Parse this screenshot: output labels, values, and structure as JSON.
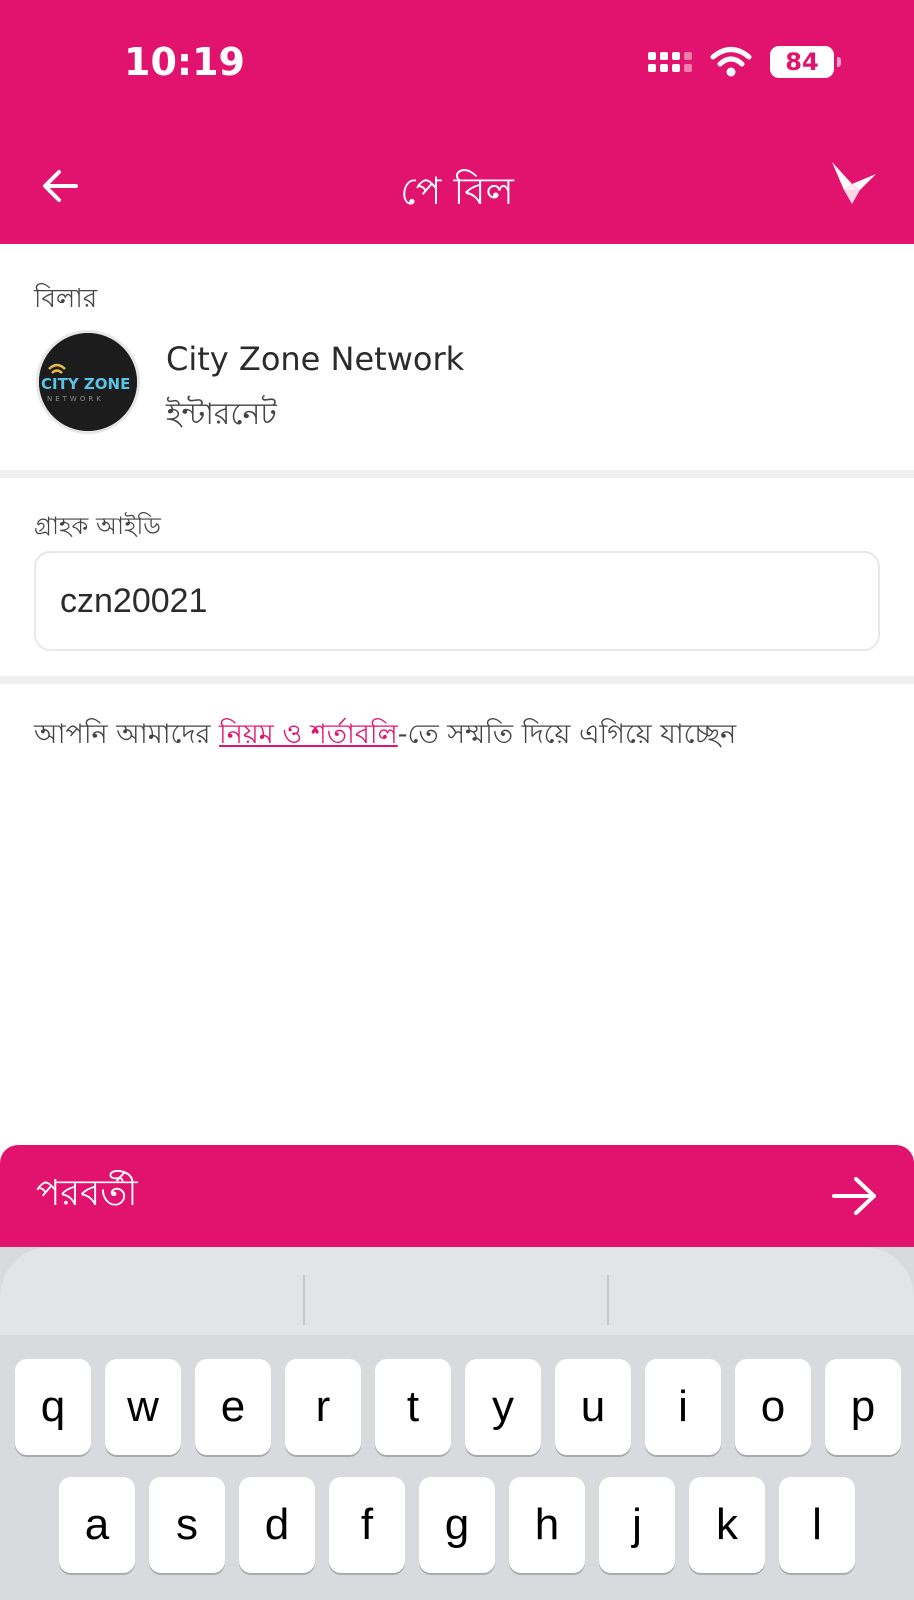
{
  "status_bar": {
    "time": "10:19",
    "battery": "84"
  },
  "header": {
    "title": "পে বিল"
  },
  "biller": {
    "label": "বিলার",
    "name": "City Zone Network",
    "category": "ইন্টারনেট",
    "logo_text_top": "CITY ZONE",
    "logo_text_bottom": "NETWORK"
  },
  "customer": {
    "label": "গ্রাহক আইডি",
    "value": "czn20021"
  },
  "terms": {
    "prefix": "আপনি আমাদের ",
    "link": "নিয়ম ও শর্তাবলি",
    "suffix": "-তে সম্মতি দিয়ে এগিয়ে যাচ্ছেন"
  },
  "next_button": {
    "label": "পরবর্তী"
  },
  "keyboard": {
    "row1": [
      "q",
      "w",
      "e",
      "r",
      "t",
      "y",
      "u",
      "i",
      "o",
      "p"
    ],
    "row2": [
      "a",
      "s",
      "d",
      "f",
      "g",
      "h",
      "j",
      "k",
      "l"
    ]
  },
  "colors": {
    "brand": "#e2136e",
    "keyboard_bg": "#d9dade",
    "divider": "#f0f0f0"
  }
}
